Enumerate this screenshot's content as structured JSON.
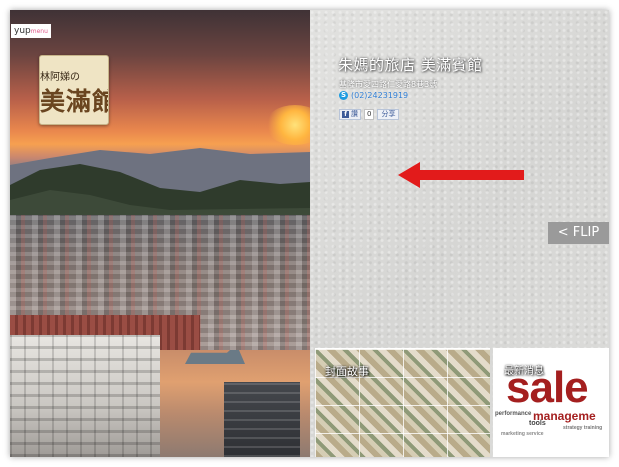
{
  "header": {
    "brand_main": "yup",
    "brand_sub": "menu"
  },
  "business": {
    "logo_line1": "林阿娣の",
    "logo_line2": "美滿館",
    "title": "朱媽的旅店 美滿賓館",
    "address": "基隆市愛四路仁愛路8巷3號",
    "phone": "(02)24231919"
  },
  "social": {
    "like_label": "讚",
    "like_count": "0",
    "share_label": "分享"
  },
  "controls": {
    "flip_label": "< FLIP"
  },
  "thumbnails": [
    {
      "label": "封面故事"
    },
    {
      "label": "最新消息"
    }
  ],
  "sale_cloud": {
    "words": [
      "sale",
      "manageme",
      "performance",
      "tools"
    ],
    "minor": [
      "strategy  training",
      "marketing  service"
    ]
  },
  "colors": {
    "arrow": "#e21b1b",
    "flip_bg": "#9a9a9a",
    "phone": "#2d7bd1"
  }
}
